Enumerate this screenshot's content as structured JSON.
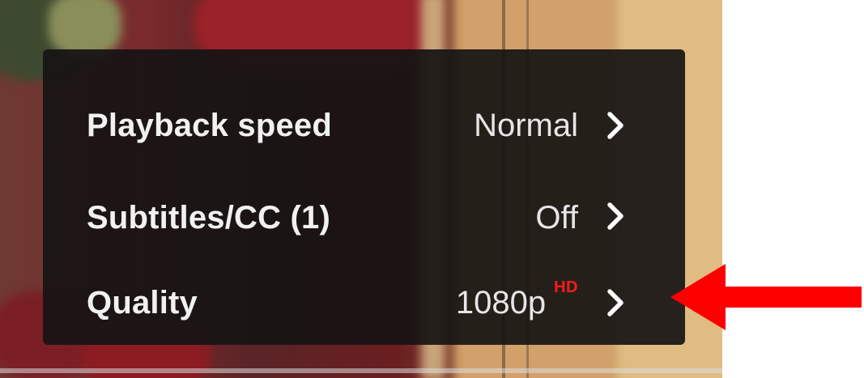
{
  "settings_menu": {
    "items": [
      {
        "label": "Playback speed",
        "value": "Normal",
        "badge": "",
        "icon": "chevron-right-icon"
      },
      {
        "label": "Subtitles/CC (1)",
        "value": "Off",
        "badge": "",
        "icon": "chevron-right-icon"
      },
      {
        "label": "Quality",
        "value": "1080p",
        "badge": "HD",
        "icon": "chevron-right-icon"
      }
    ]
  },
  "annotation": {
    "icon": "red-arrow-icon",
    "color": "#ff0000"
  },
  "colors": {
    "menu_background": "#161413",
    "text": "#f1f1f1",
    "hd_badge": "#ff1a1a"
  }
}
